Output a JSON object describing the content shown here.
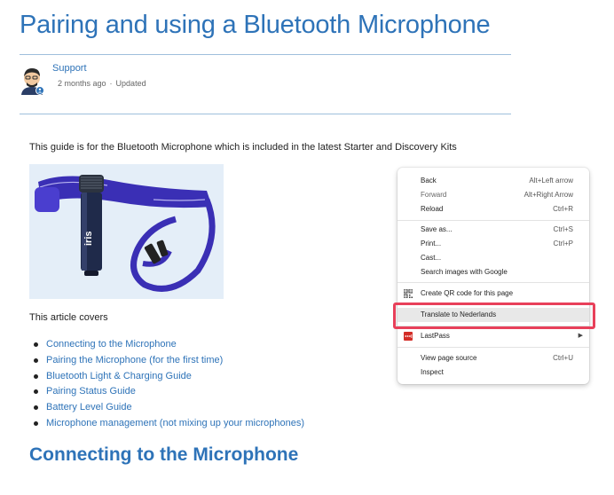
{
  "article": {
    "title": "Pairing and using a Bluetooth Microphone",
    "author": "Support",
    "meta_time": "2 months ago",
    "meta_sep": "·",
    "meta_updated": "Updated",
    "intro": "This guide is for the Bluetooth Microphone which is included in the latest Starter and Discovery Kits",
    "covers_label": "This article covers",
    "toc": [
      "Connecting to the Microphone",
      "Pairing the Microphone (for the first time)",
      "Bluetooth Light & Charging Guide",
      "Pairing Status Guide",
      "Battery Level Guide",
      "Microphone management (not mixing up your microphones)"
    ],
    "section_heading": "Connecting to the Microphone"
  },
  "context_menu": {
    "back": {
      "label": "Back",
      "shortcut": "Alt+Left arrow"
    },
    "forward": {
      "label": "Forward",
      "shortcut": "Alt+Right Arrow"
    },
    "reload": {
      "label": "Reload",
      "shortcut": "Ctrl+R"
    },
    "save_as": {
      "label": "Save as...",
      "shortcut": "Ctrl+S"
    },
    "print": {
      "label": "Print...",
      "shortcut": "Ctrl+P"
    },
    "cast": {
      "label": "Cast..."
    },
    "search_images": {
      "label": "Search images with Google"
    },
    "qr_code": {
      "label": "Create QR code for this page",
      "icon": "qr-code-icon"
    },
    "translate": {
      "label": "Translate to Nederlands"
    },
    "lastpass": {
      "label": "LastPass",
      "icon": "lastpass-icon"
    },
    "view_source": {
      "label": "View page source",
      "shortcut": "Ctrl+U"
    },
    "inspect": {
      "label": "Inspect"
    }
  },
  "colors": {
    "link": "#2e73b8",
    "highlight_border": "#e8405a",
    "lastpass_red": "#d32d27"
  }
}
